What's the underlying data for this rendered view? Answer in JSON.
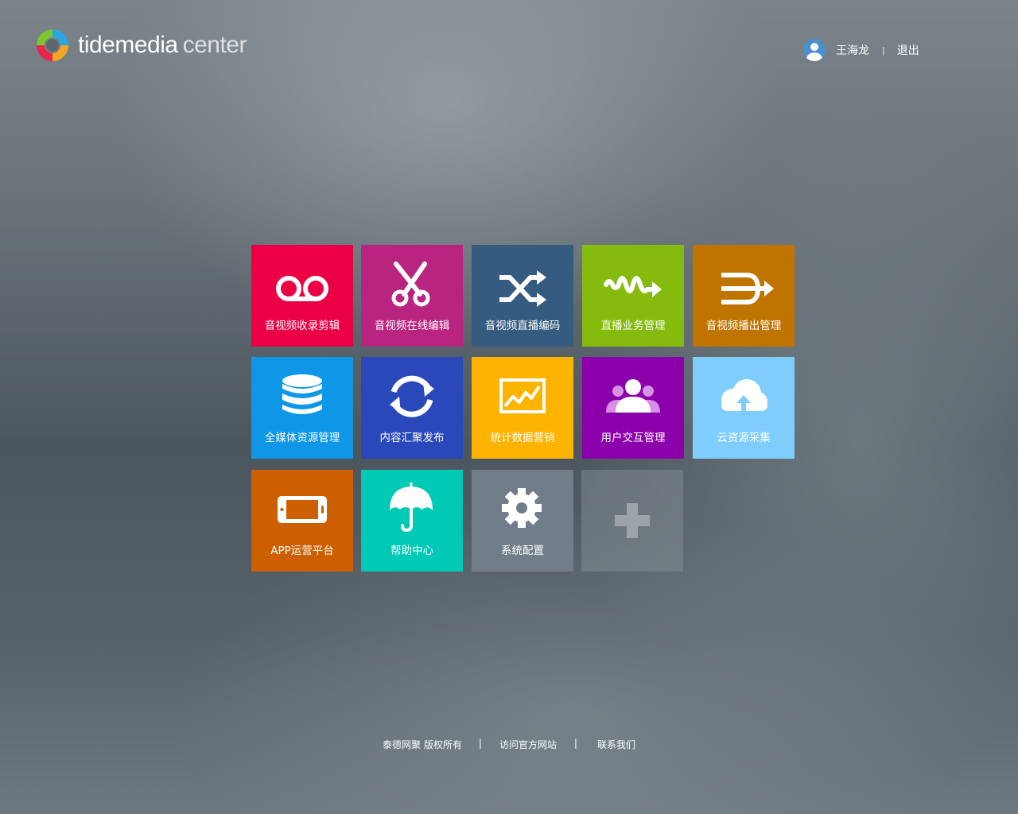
{
  "brand": {
    "name_main": "tidemedia",
    "name_sub": "center",
    "icon": "tidemedia-logo-icon"
  },
  "header": {
    "user_name": "王海龙",
    "separator": "|",
    "logout_label": "退出",
    "avatar_icon": "user-avatar-icon"
  },
  "tiles": [
    {
      "label": "音视频收录剪辑",
      "icon": "voicemail-icon",
      "color": "#eb0045"
    },
    {
      "label": "音视频在线编辑",
      "icon": "scissors-icon",
      "color": "#b8247f"
    },
    {
      "label": "音视频直播编码",
      "icon": "shuffle-icon",
      "color": "#355b80"
    },
    {
      "label": "直播业务管理",
      "icon": "wave-arrow-icon",
      "color": "#84bb0c"
    },
    {
      "label": "音视频播出管理",
      "icon": "trident-arrow-icon",
      "color": "#c07400"
    },
    {
      "label": "全媒体资源管理",
      "icon": "database-icon",
      "color": "#0d97e6"
    },
    {
      "label": "内容汇聚发布",
      "icon": "refresh-icon",
      "color": "#2a48ba"
    },
    {
      "label": "统计数据营销",
      "icon": "line-chart-icon",
      "color": "#fdb400"
    },
    {
      "label": "用户交互管理",
      "icon": "users-icon",
      "color": "#8c00ab"
    },
    {
      "label": "云资源采集",
      "icon": "cloud-upload-icon",
      "color": "#7ecdfd"
    },
    {
      "label": "APP运营平台",
      "icon": "mobile-landscape-icon",
      "color": "#cc5f00"
    },
    {
      "label": "帮助中心",
      "icon": "umbrella-icon",
      "color": "#00c9b5"
    },
    {
      "label": "系统配置",
      "icon": "gear-icon",
      "color": "#717e8a"
    },
    {
      "label": "",
      "icon": "plus-icon",
      "color": "#8a929a"
    }
  ],
  "footer": {
    "copyright": "泰德网聚  版权所有",
    "separator": "|",
    "visit_label": "访问官方网站",
    "contact_label": "联系我们"
  }
}
